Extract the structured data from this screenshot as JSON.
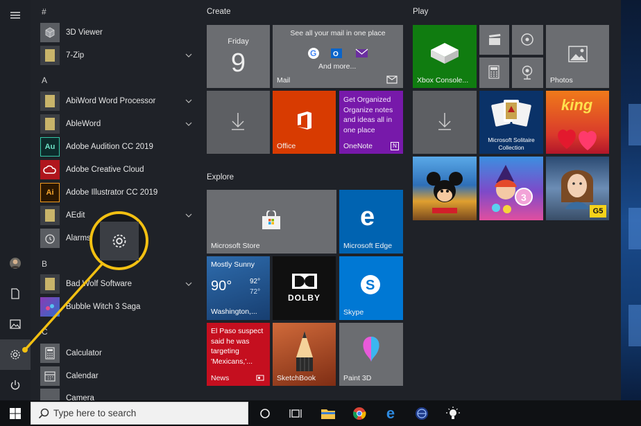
{
  "colors": {
    "accent_callout": "#f2c012",
    "xbox_green": "#107c10",
    "office_orange": "#d83b01",
    "onenote_purple": "#7719aa",
    "edge_blue": "#0063b1",
    "news_red": "#c50f1f",
    "paint3d_gray": "#6b6d71",
    "skype_blue": "#0078d4"
  },
  "applist": {
    "letters": {
      "hash": "#",
      "a": "A",
      "b": "B",
      "c": "C"
    },
    "apps": [
      {
        "name": "3D Viewer"
      },
      {
        "name": "7-Zip"
      },
      {
        "name": "AbiWord Word Processor"
      },
      {
        "name": "AbleWord"
      },
      {
        "name": "Adobe Audition CC 2019",
        "icon_text": "Au"
      },
      {
        "name": "Adobe Creative Cloud"
      },
      {
        "name": "Adobe Illustrator CC 2019",
        "icon_text": "Ai"
      },
      {
        "name": "AEdit"
      },
      {
        "name": "Alarms"
      },
      {
        "name": "Bad Wolf Software"
      },
      {
        "name": "Bubble Witch 3 Saga"
      },
      {
        "name": "Calculator"
      },
      {
        "name": "Calendar"
      },
      {
        "name": "Camera"
      }
    ]
  },
  "groups": {
    "create": "Create",
    "explore": "Explore",
    "play": "Play"
  },
  "tiles": {
    "calendar": {
      "day": "Friday",
      "date": "9"
    },
    "mail": {
      "promo": "See all your mail in one place",
      "more": "And more...",
      "label": "Mail"
    },
    "office": {
      "label": "Office"
    },
    "onenote": {
      "promo": "Get Organized Organize notes and ideas all in one place",
      "label": "OneNote",
      "badge": "N"
    },
    "xbox": {
      "label": "Xbox Console..."
    },
    "photos": {
      "label": "Photos"
    },
    "king": {
      "logo": "king"
    },
    "solitaire": {
      "label": "Microsoft Solitaire Collection"
    },
    "store": {
      "label": "Microsoft Store"
    },
    "edge": {
      "label": "Microsoft Edge"
    },
    "weather": {
      "condition": "Mostly Sunny",
      "temp": "90°",
      "high": "92°",
      "low": "72°",
      "location": "Washington,..."
    },
    "dolby": {
      "logo": "DOLBY"
    },
    "skype": {
      "label": "Skype"
    },
    "news": {
      "headline": "El Paso suspect said he was targeting 'Mexicans,'...",
      "label": "News"
    },
    "sketchbook": {
      "label": "SketchBook"
    },
    "paint3d": {
      "label": "Paint 3D"
    },
    "g5": {
      "badge": "G5"
    }
  },
  "taskbar": {
    "search_placeholder": "Type here to search"
  }
}
